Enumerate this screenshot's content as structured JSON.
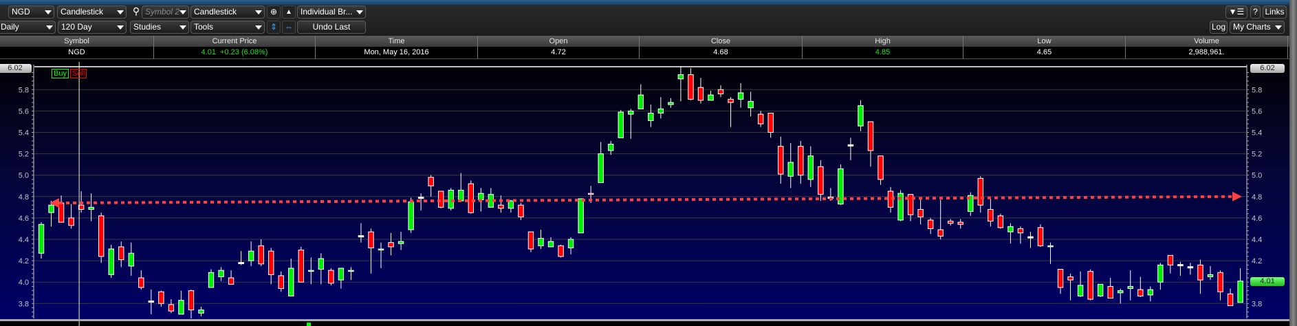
{
  "toolbar": {
    "symbol": "NGD",
    "chart_type": "Candlestick",
    "symbol2_placeholder": "Symbol 2",
    "chart_type2": "Candlestick",
    "layout": "Individual Br...",
    "interval": "Daily",
    "range": "120 Day",
    "studies": "Studies",
    "tools": "Tools",
    "undo": "Undo Last",
    "help": "?",
    "links": "Links",
    "log": "Log",
    "my_charts": "My Charts"
  },
  "quote": {
    "headers": [
      "Symbol",
      "Current Price",
      "Time",
      "Open",
      "Close",
      "High",
      "Low",
      "Volume"
    ],
    "symbol": "NGD",
    "current_price": "4.01  +0.23 (6.08%)",
    "time": "Mon, May 16, 2016",
    "open": "4.72",
    "close": "4.68",
    "high": "4.85",
    "low": "4.65",
    "volume": "2,988,961."
  },
  "chart": {
    "buy": "Buy",
    "sell": "Sell",
    "top_price": "6.02",
    "last_price": "4.01"
  },
  "chart_data": {
    "type": "candlestick",
    "ylim": [
      3.66,
      6.02
    ],
    "yticks": [
      "3.8",
      "4.0",
      "4.2",
      "4.4",
      "4.6",
      "4.8",
      "5.0",
      "5.2",
      "5.4",
      "5.6",
      "5.8"
    ],
    "colors": {
      "up": "#00ee00",
      "down": "#ff0000",
      "trend": "#ff4040"
    },
    "trendline": [
      4.74,
      4.8
    ],
    "crosshair_index": 4,
    "ohlc": [
      [
        4.27,
        4.56,
        4.22,
        4.54
      ],
      [
        4.65,
        4.76,
        4.52,
        4.72
      ],
      [
        4.74,
        4.81,
        4.56,
        4.56
      ],
      [
        4.6,
        4.73,
        4.5,
        4.53
      ],
      [
        4.72,
        4.85,
        4.65,
        4.68
      ],
      [
        4.68,
        4.83,
        4.57,
        4.7
      ],
      [
        4.62,
        4.65,
        4.18,
        4.24
      ],
      [
        4.07,
        4.35,
        4.04,
        4.31
      ],
      [
        4.33,
        4.38,
        4.14,
        4.21
      ],
      [
        4.15,
        4.37,
        4.06,
        4.27
      ],
      [
        4.04,
        4.11,
        3.93,
        3.95
      ],
      [
        3.82,
        3.93,
        3.7,
        3.82
      ],
      [
        3.91,
        3.92,
        3.77,
        3.8
      ],
      [
        3.79,
        3.84,
        3.71,
        3.73
      ],
      [
        3.7,
        3.92,
        3.7,
        3.83
      ],
      [
        3.92,
        3.93,
        3.66,
        3.74
      ],
      [
        3.71,
        3.77,
        3.68,
        3.74
      ],
      [
        3.95,
        4.12,
        3.95,
        4.09
      ],
      [
        4.05,
        4.14,
        4.01,
        4.11
      ],
      [
        4.04,
        4.11,
        3.98,
        3.98
      ],
      [
        4.18,
        4.29,
        4.16,
        4.18
      ],
      [
        4.2,
        4.38,
        4.15,
        4.29
      ],
      [
        4.34,
        4.4,
        4.15,
        4.17
      ],
      [
        4.29,
        4.32,
        3.98,
        4.07
      ],
      [
        4.06,
        4.1,
        3.91,
        3.94
      ],
      [
        3.87,
        4.22,
        3.87,
        4.13
      ],
      [
        4.3,
        4.33,
        4.0,
        4.0
      ],
      [
        4.1,
        4.23,
        3.98,
        4.11
      ],
      [
        4.12,
        4.27,
        3.98,
        4.22
      ],
      [
        4.11,
        4.13,
        3.97,
        3.99
      ],
      [
        4.02,
        4.13,
        3.94,
        4.13
      ],
      [
        4.1,
        4.14,
        4.02,
        4.11
      ],
      [
        4.43,
        4.55,
        4.37,
        4.43
      ],
      [
        4.47,
        4.5,
        4.08,
        4.32
      ],
      [
        4.3,
        4.37,
        4.13,
        4.31
      ],
      [
        4.37,
        4.46,
        4.25,
        4.33
      ],
      [
        4.36,
        4.47,
        4.3,
        4.38
      ],
      [
        4.49,
        4.79,
        4.46,
        4.75
      ],
      [
        4.79,
        4.83,
        4.67,
        4.79
      ],
      [
        4.98,
        5.0,
        4.8,
        4.9
      ],
      [
        4.85,
        4.85,
        4.69,
        4.7
      ],
      [
        4.69,
        4.88,
        4.67,
        4.86
      ],
      [
        4.76,
        5.02,
        4.76,
        4.86
      ],
      [
        4.92,
        4.95,
        4.64,
        4.65
      ],
      [
        4.77,
        4.88,
        4.66,
        4.83
      ],
      [
        4.7,
        4.88,
        4.7,
        4.82
      ],
      [
        4.72,
        4.81,
        4.65,
        4.69
      ],
      [
        4.69,
        4.77,
        4.65,
        4.76
      ],
      [
        4.72,
        4.74,
        4.58,
        4.61
      ],
      [
        4.47,
        4.47,
        4.28,
        4.31
      ],
      [
        4.34,
        4.49,
        4.31,
        4.41
      ],
      [
        4.33,
        4.42,
        4.33,
        4.38
      ],
      [
        4.34,
        4.35,
        4.23,
        4.24
      ],
      [
        4.32,
        4.42,
        4.26,
        4.4
      ],
      [
        4.46,
        4.78,
        4.46,
        4.78
      ],
      [
        4.83,
        4.9,
        4.74,
        4.82
      ],
      [
        4.93,
        5.31,
        4.93,
        5.2
      ],
      [
        5.23,
        5.32,
        5.19,
        5.29
      ],
      [
        5.35,
        5.61,
        5.35,
        5.59
      ],
      [
        5.57,
        5.62,
        5.34,
        5.6
      ],
      [
        5.62,
        5.85,
        5.62,
        5.75
      ],
      [
        5.51,
        5.66,
        5.45,
        5.58
      ],
      [
        5.58,
        5.73,
        5.53,
        5.62
      ],
      [
        5.66,
        5.72,
        5.63,
        5.68
      ],
      [
        5.9,
        6.02,
        5.69,
        5.94
      ],
      [
        5.94,
        6.0,
        5.7,
        5.71
      ],
      [
        5.82,
        5.91,
        5.67,
        5.7
      ],
      [
        5.7,
        5.79,
        5.7,
        5.75
      ],
      [
        5.8,
        5.84,
        5.73,
        5.76
      ],
      [
        5.71,
        5.73,
        5.45,
        5.68
      ],
      [
        5.71,
        5.86,
        5.63,
        5.77
      ],
      [
        5.63,
        5.78,
        5.55,
        5.69
      ],
      [
        5.57,
        5.6,
        5.45,
        5.48
      ],
      [
        5.58,
        5.58,
        5.35,
        5.4
      ],
      [
        5.27,
        5.36,
        4.92,
        5.01
      ],
      [
        4.99,
        5.3,
        4.88,
        5.12
      ],
      [
        5.27,
        5.32,
        4.92,
        5.0
      ],
      [
        4.96,
        5.27,
        4.89,
        5.18
      ],
      [
        5.08,
        5.14,
        4.76,
        4.82
      ],
      [
        4.79,
        4.88,
        4.76,
        4.79
      ],
      [
        4.73,
        5.1,
        4.72,
        5.06
      ],
      [
        5.28,
        5.35,
        5.14,
        5.28
      ],
      [
        5.46,
        5.7,
        5.41,
        5.65
      ],
      [
        5.5,
        5.5,
        5.08,
        5.23
      ],
      [
        5.18,
        5.18,
        4.91,
        4.96
      ],
      [
        4.85,
        4.89,
        4.65,
        4.7
      ],
      [
        4.58,
        4.86,
        4.57,
        4.83
      ],
      [
        4.82,
        4.82,
        4.57,
        4.63
      ],
      [
        4.68,
        4.78,
        4.54,
        4.61
      ],
      [
        4.58,
        4.6,
        4.45,
        4.5
      ],
      [
        4.49,
        4.77,
        4.4,
        4.43
      ],
      [
        4.57,
        4.59,
        4.53,
        4.55
      ],
      [
        4.56,
        4.59,
        4.5,
        4.54
      ],
      [
        4.66,
        4.84,
        4.62,
        4.81
      ],
      [
        4.97,
        4.99,
        4.65,
        4.72
      ],
      [
        4.68,
        4.79,
        4.52,
        4.57
      ],
      [
        4.62,
        4.64,
        4.5,
        4.51
      ],
      [
        4.47,
        4.55,
        4.36,
        4.52
      ],
      [
        4.5,
        4.52,
        4.36,
        4.46
      ],
      [
        4.42,
        4.47,
        4.32,
        4.42
      ],
      [
        4.51,
        4.54,
        4.33,
        4.34
      ],
      [
        4.33,
        4.37,
        4.17,
        4.34
      ],
      [
        4.12,
        4.12,
        3.89,
        3.95
      ],
      [
        4.05,
        4.08,
        3.83,
        4.02
      ],
      [
        3.87,
        4.1,
        3.86,
        3.97
      ],
      [
        4.1,
        4.12,
        3.83,
        3.84
      ],
      [
        3.87,
        3.98,
        3.86,
        3.98
      ],
      [
        3.96,
        4.04,
        3.85,
        3.85
      ],
      [
        3.9,
        3.94,
        3.8,
        3.92
      ],
      [
        3.94,
        4.11,
        3.83,
        3.96
      ],
      [
        3.93,
        4.05,
        3.86,
        3.87
      ],
      [
        3.88,
        3.96,
        3.82,
        3.93
      ],
      [
        4.0,
        4.18,
        3.93,
        4.16
      ],
      [
        4.25,
        4.25,
        4.08,
        4.16
      ],
      [
        4.16,
        4.19,
        4.06,
        4.16
      ],
      [
        4.14,
        4.18,
        4.07,
        4.14
      ],
      [
        4.16,
        4.21,
        3.89,
        4.02
      ],
      [
        4.05,
        4.15,
        4.02,
        4.07
      ],
      [
        4.09,
        4.11,
        3.83,
        3.91
      ],
      [
        3.89,
        3.94,
        3.78,
        3.78
      ],
      [
        3.81,
        4.13,
        3.81,
        4.01
      ]
    ]
  }
}
